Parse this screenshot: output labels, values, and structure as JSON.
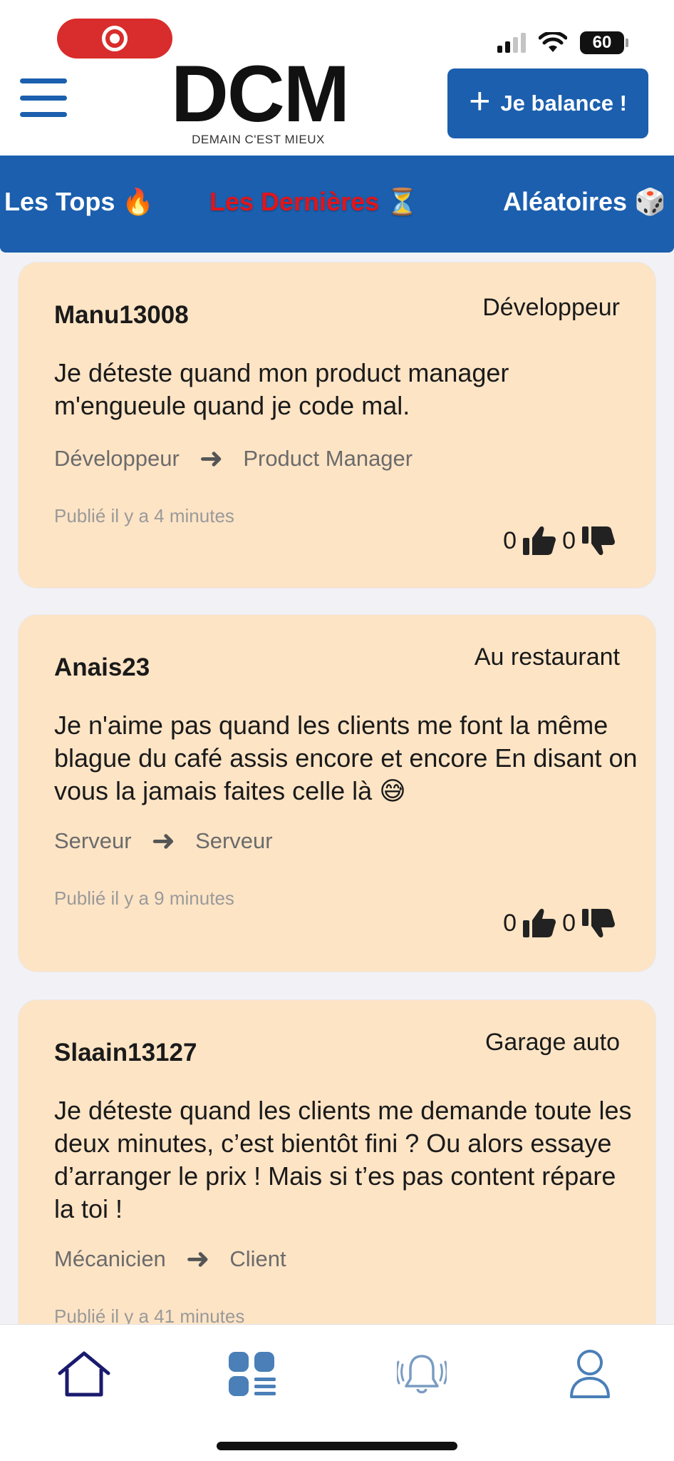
{
  "status_bar": {
    "battery_level": "60",
    "icons": [
      "screen-record-icon",
      "cellular-signal-icon",
      "wifi-icon",
      "battery-icon"
    ]
  },
  "header": {
    "logo_text": "DCM",
    "tagline": "DEMAIN C'EST MIEUX",
    "post_button_label": "Je balance !",
    "post_button_icon": "plus-icon",
    "menu_icon": "hamburger-menu-icon"
  },
  "tabs": [
    {
      "label": "Les Tops",
      "emoji": "🔥",
      "active": false
    },
    {
      "label": "Les Dernières",
      "emoji": "⏳",
      "active": true
    },
    {
      "label": "Aléatoires",
      "emoji": "🎲",
      "active": false
    }
  ],
  "posts": [
    {
      "author": "Manu13008",
      "category": "Développeur",
      "text": "Je déteste quand mon product manager m'engueule quand je code mal.",
      "from": "Développeur",
      "to": "Product Manager",
      "published": "Publié il y a 4 minutes",
      "likes": "0",
      "dislikes": "0"
    },
    {
      "author": "Anais23",
      "category": "Au restaurant",
      "text": "Je n'aime pas quand les clients me font la même blague du café assis encore et encore En disant on vous la jamais faites celle là 😅",
      "from": "Serveur",
      "to": "Serveur",
      "published": "Publié il y a 9 minutes",
      "likes": "0",
      "dislikes": "0"
    },
    {
      "author": "Slaain13127",
      "category": "Garage auto",
      "text": "Je déteste quand les clients me demande toute les deux minutes, c’est bientôt fini ? Ou alors essaye d’arranger le prix ! Mais si t’es pas content répare la toi !",
      "from": "Mécanicien",
      "to": "Client",
      "published": "Publié il y a 41 minutes"
    }
  ],
  "bottom_nav": [
    {
      "icon": "home-icon",
      "active": true
    },
    {
      "icon": "grid-list-icon",
      "active": false
    },
    {
      "icon": "bell-icon",
      "active": false
    },
    {
      "icon": "profile-icon",
      "active": false
    }
  ],
  "colors": {
    "brand_blue": "#1b5fae",
    "active_tab_red": "#e0151b",
    "card_bg": "#fde4c5",
    "record_red": "#d92c2c"
  }
}
